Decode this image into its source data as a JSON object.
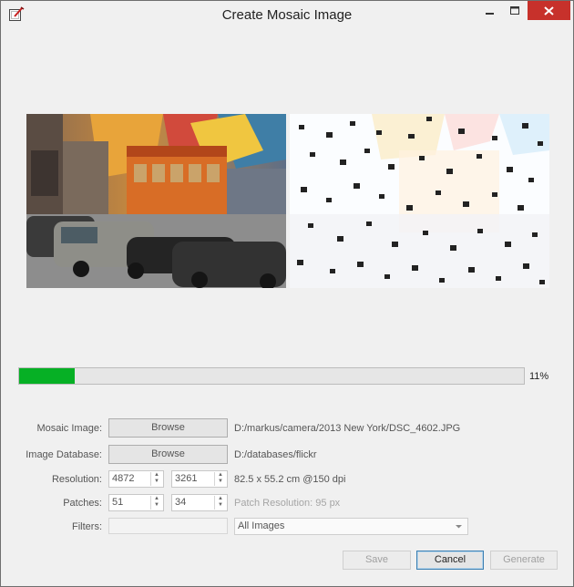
{
  "window": {
    "title": "Create Mosaic Image"
  },
  "progress": {
    "percent": 11,
    "label": "11%"
  },
  "form": {
    "mosaic_image": {
      "label": "Mosaic Image:",
      "button": "Browse",
      "path": "D:/markus/camera/2013 New York/DSC_4602.JPG"
    },
    "image_database": {
      "label": "Image Database:",
      "button": "Browse",
      "path": "D:/databases/flickr"
    },
    "resolution": {
      "label": "Resolution:",
      "width": "4872",
      "height": "3261",
      "info": "82.5 x 55.2 cm @150 dpi"
    },
    "patches": {
      "label": "Patches:",
      "cols": "51",
      "rows": "34",
      "info": "Patch Resolution: 95 px"
    },
    "filters": {
      "label": "Filters:",
      "value": "",
      "selected": "All Images"
    }
  },
  "buttons": {
    "save": "Save",
    "cancel": "Cancel",
    "generate": "Generate"
  },
  "colors": {
    "progress_fill": "#06b025",
    "close_button": "#c7312b"
  }
}
